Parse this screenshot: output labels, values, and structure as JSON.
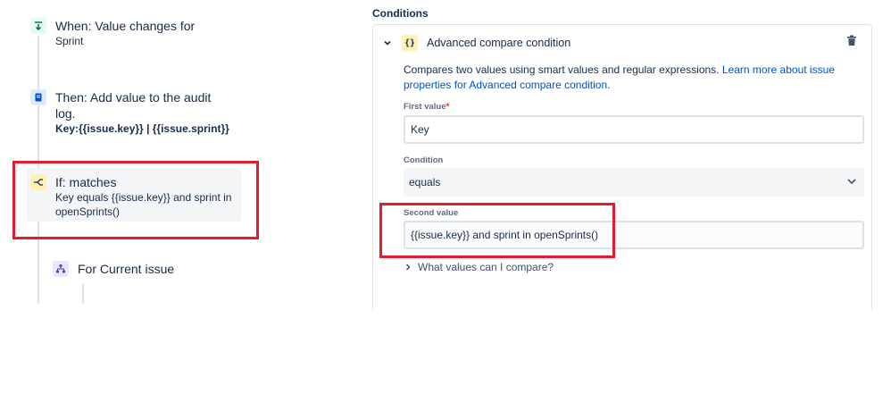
{
  "rule_nodes": {
    "trigger": {
      "title": "When: Value changes for",
      "sub": "Sprint"
    },
    "action": {
      "title_line1": "Then: Add value to the audit",
      "title_line2": "log.",
      "sub": "Key:{{issue.key}} | {{issue.sprint}}"
    },
    "condition": {
      "title": "If: matches",
      "sub_line1": "Key equals {{issue.key}} and sprint in",
      "sub_line2": "openSprints()"
    },
    "branch": {
      "title": "For Current issue"
    }
  },
  "panel": {
    "section_label": "Conditions",
    "card_title": "Advanced compare condition",
    "description_text": "Compares two values using smart values and regular expressions.",
    "description_link": "Learn more about issue properties for Advanced compare condition",
    "description_end": ".",
    "first_value_label": "First value",
    "required_mark": "*",
    "first_value": "Key",
    "condition_label": "Condition",
    "condition_value": "equals",
    "second_value_label": "Second value",
    "second_value": "{{issue.key}} and sprint in openSprints()",
    "expander_label": "What values can I compare?"
  },
  "colors": {
    "trigger_icon_bg": "#e3fcef",
    "action_icon_bg": "#deebff",
    "condition_icon_bg": "#fff0b3",
    "branch_icon_bg": "#eae6ff",
    "highlight": "#e01e2d",
    "link": "#0052cc"
  },
  "icons": {
    "trigger": "download-arrow-icon",
    "action": "document-icon",
    "condition": "branch-fork-icon",
    "branch": "hierarchy-icon",
    "collapse": "chevron-down-icon",
    "card": "curly-braces-icon",
    "delete": "trash-icon",
    "dropdown": "chevron-down-icon",
    "expander": "chevron-right-icon"
  }
}
